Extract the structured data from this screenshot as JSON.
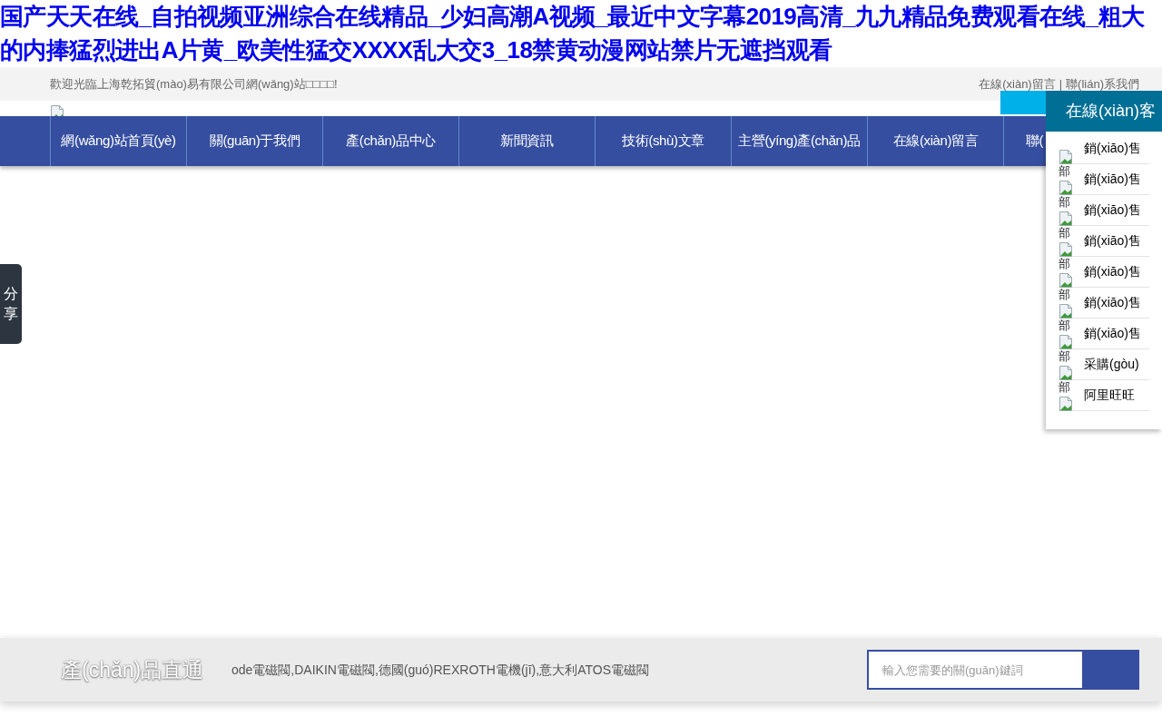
{
  "headline": "国产天天在线_自拍视频亚洲综合在线精品_少妇高潮A视频_最近中文字幕2019高清_九九精品免费观看在线_粗大的内捧猛烈进出A片黄_欧美性猛交XXXX乱大交3_18禁黄动漫网站禁片无遮挡观看",
  "top_bar": {
    "welcome": "歡迎光臨上海乾拓貿(mào)易有限公司網(wǎng)站□□□□!",
    "links": [
      "在線(xiàn)留言",
      "聯(lián)系我們"
    ],
    "separator": "|"
  },
  "nav": [
    {
      "label": "網(wǎng)站首頁(yè)"
    },
    {
      "label": "關(guān)于我們"
    },
    {
      "label": "產(chǎn)品中心"
    },
    {
      "label": "新聞資訊"
    },
    {
      "label": "技術(shù)文章"
    },
    {
      "label": "主營(yíng)產(chǎn)品"
    },
    {
      "label": "在線(xiàn)留言"
    },
    {
      "label": "聯("
    }
  ],
  "share_tab": {
    "label": "分享"
  },
  "service_panel": {
    "title": "在線(xiàn)客",
    "items": [
      {
        "label": "銷(xiāo)售",
        "suffix": "部"
      },
      {
        "label": "銷(xiāo)售",
        "suffix": "部"
      },
      {
        "label": "銷(xiāo)售",
        "suffix": "部"
      },
      {
        "label": "銷(xiāo)售",
        "suffix": "部"
      },
      {
        "label": "銷(xiāo)售",
        "suffix": "部"
      },
      {
        "label": "銷(xiāo)售",
        "suffix": "部"
      },
      {
        "label": "銷(xiāo)售",
        "suffix": "部"
      },
      {
        "label": "采購(gòu)",
        "suffix": "部"
      },
      {
        "label": "阿里旺旺"
      }
    ]
  },
  "product_bar": {
    "title": "產(chǎn)品直通",
    "keywords": "ode電磁閥,DAIKIN電磁閥,德國(guó)REXROTH電機(jī),意大利ATOS電磁閥",
    "search": {
      "placeholder": "輸入您需要的關(guān)鍵詞"
    }
  }
}
